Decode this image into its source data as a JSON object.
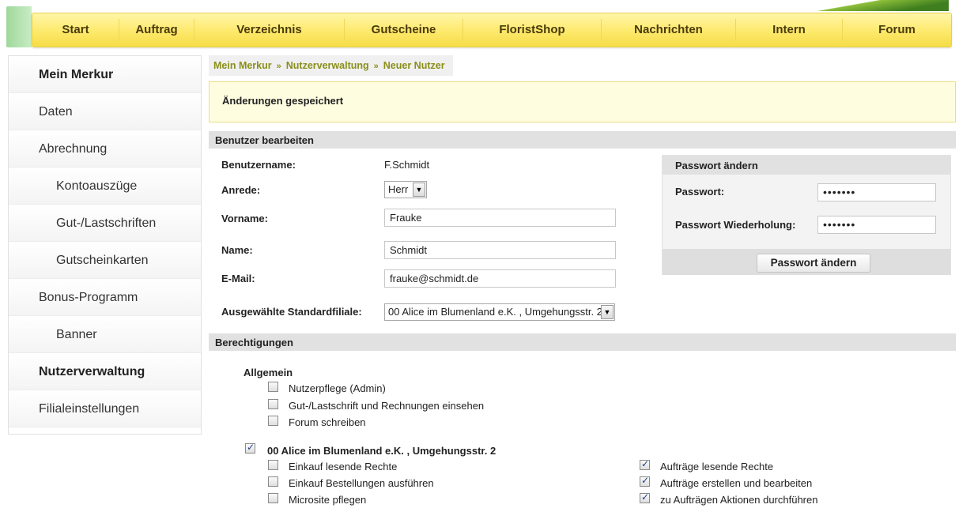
{
  "nav": {
    "items": [
      "Start",
      "Auftrag",
      "Verzeichnis",
      "Gutscheine",
      "FloristShop",
      "Nachrichten",
      "Intern",
      "Forum"
    ]
  },
  "sidebar": {
    "items": [
      {
        "label": "Mein Merkur",
        "bold": true,
        "sub": false
      },
      {
        "label": "Daten",
        "bold": false,
        "sub": false
      },
      {
        "label": "Abrechnung",
        "bold": false,
        "sub": false
      },
      {
        "label": "Kontoauszüge",
        "bold": false,
        "sub": true
      },
      {
        "label": "Gut-/Lastschriften",
        "bold": false,
        "sub": true
      },
      {
        "label": "Gutscheinkarten",
        "bold": false,
        "sub": true
      },
      {
        "label": "Bonus-Programm",
        "bold": false,
        "sub": false
      },
      {
        "label": "Banner",
        "bold": false,
        "sub": true
      },
      {
        "label": "Nutzerverwaltung",
        "bold": true,
        "sub": false
      },
      {
        "label": "Filialeinstellungen",
        "bold": false,
        "sub": false
      }
    ]
  },
  "breadcrumb": {
    "items": [
      "Mein Merkur",
      "Nutzerverwaltung",
      "Neuer Nutzer"
    ],
    "separator": "»"
  },
  "notice": "Änderungen gespeichert",
  "edit": {
    "heading": "Benutzer bearbeiten",
    "username_label": "Benutzername:",
    "username_value": "F.Schmidt",
    "salutation_label": "Anrede:",
    "salutation_value": "Herr",
    "firstname_label": "Vorname:",
    "firstname_value": "Frauke",
    "lastname_label": "Name:",
    "lastname_value": "Schmidt",
    "email_label": "E-Mail:",
    "email_value": "frauke@schmidt.de",
    "branch_label": "Ausgewählte Standardfiliale:",
    "branch_value": "00 Alice im Blumenland e.K. , Umgehungsstr. 2"
  },
  "password": {
    "heading": "Passwort ändern",
    "pw_label": "Passwort:",
    "pw_value": "•••••••",
    "pw_repeat_label": "Passwort Wiederholung:",
    "pw_repeat_value": "•••••••",
    "button": "Passwort ändern"
  },
  "permissions": {
    "heading": "Berechtigungen",
    "general_title": "Allgemein",
    "general": [
      {
        "label": "Nutzerpflege (Admin)",
        "checked": false
      },
      {
        "label": "Gut-/Lastschrift und Rechnungen einsehen",
        "checked": false
      },
      {
        "label": "Forum schreiben",
        "checked": false
      }
    ],
    "branch_title": "00 Alice im Blumenland e.K. , Umgehungsstr. 2",
    "branch_checked": true,
    "branch_left": [
      {
        "label": "Einkauf lesende Rechte",
        "checked": false
      },
      {
        "label": "Einkauf Bestellungen ausführen",
        "checked": false
      },
      {
        "label": "Microsite pflegen",
        "checked": false
      }
    ],
    "branch_right": [
      {
        "label": "Aufträge lesende Rechte",
        "checked": true
      },
      {
        "label": "Aufträge erstellen und bearbeiten",
        "checked": true
      },
      {
        "label": "zu Aufträgen Aktionen durchführen",
        "checked": true
      }
    ]
  }
}
